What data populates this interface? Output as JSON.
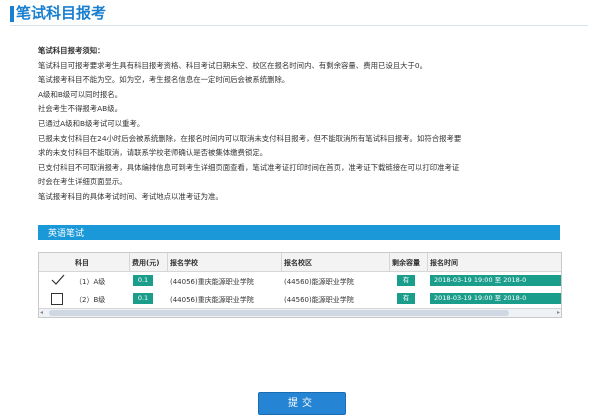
{
  "header": {
    "title": "笔试科目报考"
  },
  "notice": {
    "title": "笔试科目报考须知：",
    "lines": [
      "笔试科目可报考要求考生具有科目报考资格、科目考试日期未空、校区在报名时间内、有剩余容量、费用已设且大于0。",
      "笔试报考科目不能为空。如为空，考生报名信息在一定时间后会被系统删除。",
      "A级和B级可以同时报名。",
      "社会考生不得报考AB级。",
      "已通过A级和B级考试可以重考。",
      "已报未支付科目在24小时后会被系统删除，在报名时间内可以取消未支付科目报考，但不能取消所有笔试科目报考。如符合报考要",
      "求的未支付科目不能取消，请联系学校老师确认是否被集体缴费锁定。",
      "已支付科目不可取消报考，具体编排信息可到考生详细页面查看，笔试准考证打印时间在首页，准考证下载链接在可以打印准考证",
      "时会在考生详细页面显示。",
      "笔试报考科目的具体考试时间、考试地点以准考证为准。"
    ]
  },
  "section": {
    "title": "英语笔试"
  },
  "table": {
    "headers": [
      "科目",
      "费用(元)",
      "报名学校",
      "报名校区",
      "剩余容量",
      "报名时间"
    ],
    "rows": [
      {
        "checked": true,
        "subject": "（1）A级",
        "fee": "0.1",
        "school": "(44056)重庆能源职业学院",
        "campus": "(44560)能源职业学院",
        "capacity": "有",
        "time": "2018-03-19 19:00 至 2018-0"
      },
      {
        "checked": false,
        "subject": "（2）B级",
        "fee": "0.1",
        "school": "(44056)重庆能源职业学院",
        "campus": "(44560)能源职业学院",
        "capacity": "有",
        "time": "2018-03-19 19:00 至 2018-0"
      }
    ]
  },
  "submit": {
    "label": "提交"
  },
  "colors": {
    "accent": "#1b7fd0",
    "section": "#1b98d8",
    "badge": "#1b9d8c",
    "button": "#2585d4"
  },
  "icons": {
    "check": "checkmark-icon",
    "unchecked": "checkbox-icon",
    "scroll_left": "arrow-left-icon",
    "scroll_right": "arrow-right-icon"
  }
}
